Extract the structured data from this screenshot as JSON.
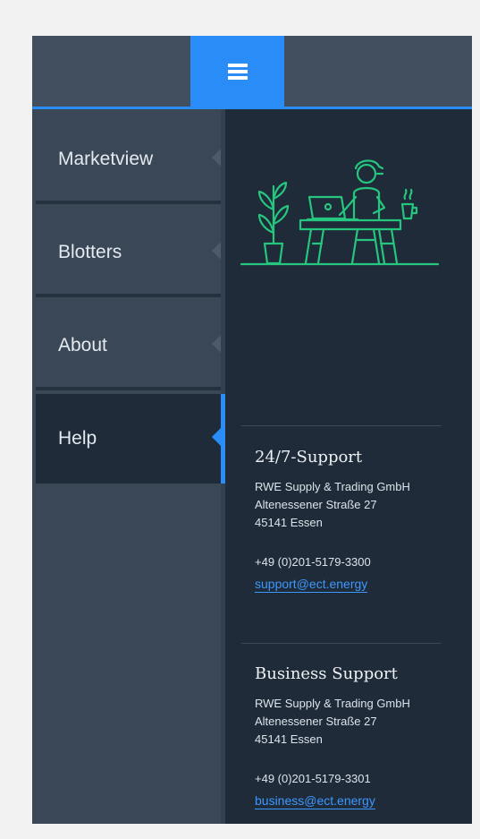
{
  "header": {
    "menu_icon": "hamburger-menu-icon"
  },
  "sidebar": {
    "items": [
      {
        "label": "Marketview",
        "active": false
      },
      {
        "label": "Blotters",
        "active": false
      },
      {
        "label": "About",
        "active": false
      },
      {
        "label": "Help",
        "active": true
      }
    ]
  },
  "help": {
    "illustration_icon": "person-at-desk-illustration-icon",
    "support": {
      "title": "24/7-Support",
      "company": "RWE Supply & Trading GmbH",
      "street": "Altenessener Straße 27",
      "city": "45141 Essen",
      "phone": "+49 (0)201-5179-3300",
      "email": "support@ect.energy"
    },
    "business": {
      "title": "Business Support",
      "company": "RWE Supply & Trading GmbH",
      "street": "Altenessener Straße 27",
      "city": "45141 Essen",
      "phone": "+49 (0)201-5179-3301",
      "email": "business@ect.energy"
    }
  },
  "colors": {
    "accent": "#2a8cf7",
    "illustration": "#25c77f",
    "sidebar_bg": "#3a4756",
    "content_bg": "#1f2b39"
  }
}
